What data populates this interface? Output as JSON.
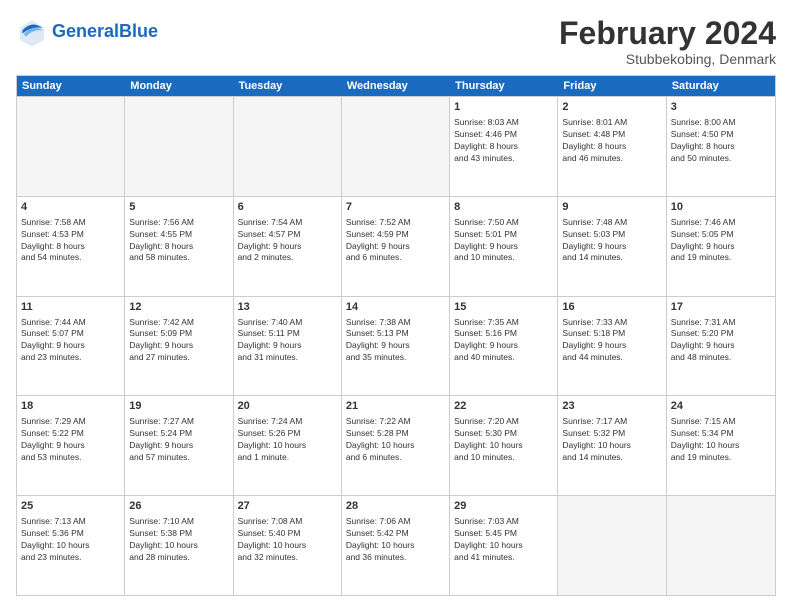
{
  "header": {
    "logo_general": "General",
    "logo_blue": "Blue",
    "month_title": "February 2024",
    "location": "Stubbekobing, Denmark"
  },
  "weekdays": [
    "Sunday",
    "Monday",
    "Tuesday",
    "Wednesday",
    "Thursday",
    "Friday",
    "Saturday"
  ],
  "rows": [
    [
      {
        "date": "",
        "info": ""
      },
      {
        "date": "",
        "info": ""
      },
      {
        "date": "",
        "info": ""
      },
      {
        "date": "",
        "info": ""
      },
      {
        "date": "1",
        "info": "Sunrise: 8:03 AM\nSunset: 4:46 PM\nDaylight: 8 hours\nand 43 minutes."
      },
      {
        "date": "2",
        "info": "Sunrise: 8:01 AM\nSunset: 4:48 PM\nDaylight: 8 hours\nand 46 minutes."
      },
      {
        "date": "3",
        "info": "Sunrise: 8:00 AM\nSunset: 4:50 PM\nDaylight: 8 hours\nand 50 minutes."
      }
    ],
    [
      {
        "date": "4",
        "info": "Sunrise: 7:58 AM\nSunset: 4:53 PM\nDaylight: 8 hours\nand 54 minutes."
      },
      {
        "date": "5",
        "info": "Sunrise: 7:56 AM\nSunset: 4:55 PM\nDaylight: 8 hours\nand 58 minutes."
      },
      {
        "date": "6",
        "info": "Sunrise: 7:54 AM\nSunset: 4:57 PM\nDaylight: 9 hours\nand 2 minutes."
      },
      {
        "date": "7",
        "info": "Sunrise: 7:52 AM\nSunset: 4:59 PM\nDaylight: 9 hours\nand 6 minutes."
      },
      {
        "date": "8",
        "info": "Sunrise: 7:50 AM\nSunset: 5:01 PM\nDaylight: 9 hours\nand 10 minutes."
      },
      {
        "date": "9",
        "info": "Sunrise: 7:48 AM\nSunset: 5:03 PM\nDaylight: 9 hours\nand 14 minutes."
      },
      {
        "date": "10",
        "info": "Sunrise: 7:46 AM\nSunset: 5:05 PM\nDaylight: 9 hours\nand 19 minutes."
      }
    ],
    [
      {
        "date": "11",
        "info": "Sunrise: 7:44 AM\nSunset: 5:07 PM\nDaylight: 9 hours\nand 23 minutes."
      },
      {
        "date": "12",
        "info": "Sunrise: 7:42 AM\nSunset: 5:09 PM\nDaylight: 9 hours\nand 27 minutes."
      },
      {
        "date": "13",
        "info": "Sunrise: 7:40 AM\nSunset: 5:11 PM\nDaylight: 9 hours\nand 31 minutes."
      },
      {
        "date": "14",
        "info": "Sunrise: 7:38 AM\nSunset: 5:13 PM\nDaylight: 9 hours\nand 35 minutes."
      },
      {
        "date": "15",
        "info": "Sunrise: 7:35 AM\nSunset: 5:16 PM\nDaylight: 9 hours\nand 40 minutes."
      },
      {
        "date": "16",
        "info": "Sunrise: 7:33 AM\nSunset: 5:18 PM\nDaylight: 9 hours\nand 44 minutes."
      },
      {
        "date": "17",
        "info": "Sunrise: 7:31 AM\nSunset: 5:20 PM\nDaylight: 9 hours\nand 48 minutes."
      }
    ],
    [
      {
        "date": "18",
        "info": "Sunrise: 7:29 AM\nSunset: 5:22 PM\nDaylight: 9 hours\nand 53 minutes."
      },
      {
        "date": "19",
        "info": "Sunrise: 7:27 AM\nSunset: 5:24 PM\nDaylight: 9 hours\nand 57 minutes."
      },
      {
        "date": "20",
        "info": "Sunrise: 7:24 AM\nSunset: 5:26 PM\nDaylight: 10 hours\nand 1 minute."
      },
      {
        "date": "21",
        "info": "Sunrise: 7:22 AM\nSunset: 5:28 PM\nDaylight: 10 hours\nand 6 minutes."
      },
      {
        "date": "22",
        "info": "Sunrise: 7:20 AM\nSunset: 5:30 PM\nDaylight: 10 hours\nand 10 minutes."
      },
      {
        "date": "23",
        "info": "Sunrise: 7:17 AM\nSunset: 5:32 PM\nDaylight: 10 hours\nand 14 minutes."
      },
      {
        "date": "24",
        "info": "Sunrise: 7:15 AM\nSunset: 5:34 PM\nDaylight: 10 hours\nand 19 minutes."
      }
    ],
    [
      {
        "date": "25",
        "info": "Sunrise: 7:13 AM\nSunset: 5:36 PM\nDaylight: 10 hours\nand 23 minutes."
      },
      {
        "date": "26",
        "info": "Sunrise: 7:10 AM\nSunset: 5:38 PM\nDaylight: 10 hours\nand 28 minutes."
      },
      {
        "date": "27",
        "info": "Sunrise: 7:08 AM\nSunset: 5:40 PM\nDaylight: 10 hours\nand 32 minutes."
      },
      {
        "date": "28",
        "info": "Sunrise: 7:06 AM\nSunset: 5:42 PM\nDaylight: 10 hours\nand 36 minutes."
      },
      {
        "date": "29",
        "info": "Sunrise: 7:03 AM\nSunset: 5:45 PM\nDaylight: 10 hours\nand 41 minutes."
      },
      {
        "date": "",
        "info": ""
      },
      {
        "date": "",
        "info": ""
      }
    ]
  ]
}
